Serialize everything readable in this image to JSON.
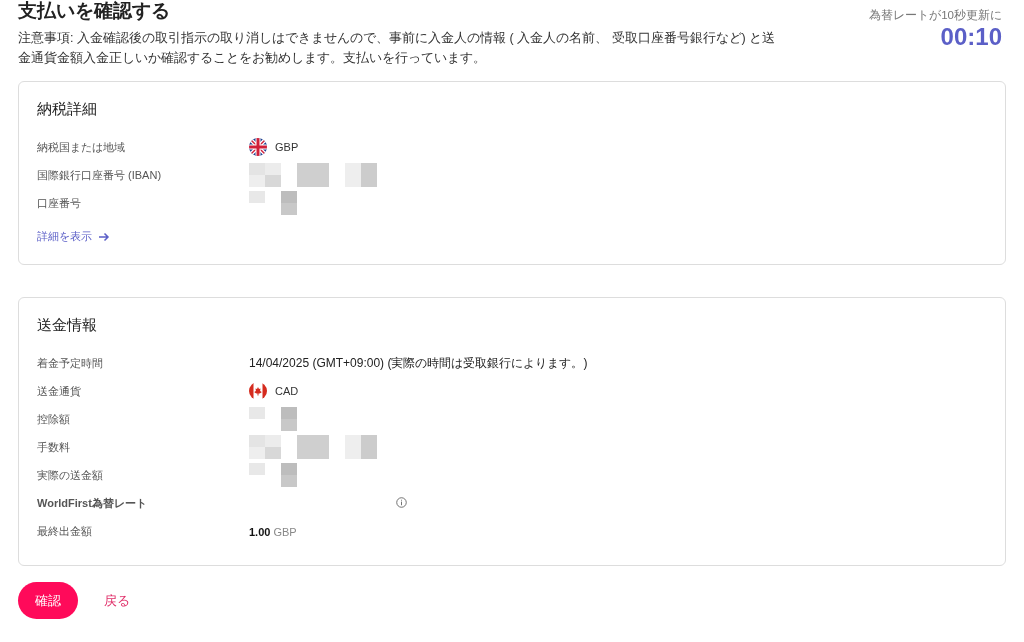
{
  "header": {
    "title": "支払いを確認する",
    "notice": "注意事項: 入金確認後の取引指示の取り消しはできませんので、事前に入金人の情報 ( 入金人の名前、 受取口座番号銀行など) と送金通貨金額入金正しいか確認することをお勧めします。支払いを行っています。",
    "rate_note": "為替レートが10秒更新に",
    "countdown": "00:10"
  },
  "sections": [
    {
      "title": "納税詳細",
      "rows": [
        {
          "label": "納税国または地域",
          "kind": "ukflag",
          "value": "GBP"
        },
        {
          "label": "国際銀行口座番号 (IBAN)",
          "kind": "redacted"
        },
        {
          "label": "口座番号",
          "kind": "redacted"
        }
      ],
      "link": "詳細を表示"
    },
    {
      "title": "送金情報",
      "rows": [
        {
          "label": "着金予定時間",
          "kind": "text",
          "value": "14/04/2025 (GMT+09:00) (実際の時間は受取銀行によります。)"
        },
        {
          "label": "送金通貨",
          "kind": "caflag",
          "value": "CAD"
        },
        {
          "label": "控除額",
          "kind": "redacted"
        },
        {
          "label": "手数料",
          "kind": "redacted"
        },
        {
          "label": "実際の送金額",
          "kind": "redacted"
        },
        {
          "label": "WorldFirst為替レート",
          "kind": "info"
        },
        {
          "label": "最終出金額",
          "kind": "amount",
          "value": "1.00",
          "unit": "GBP"
        }
      ]
    }
  ],
  "buttons": {
    "confirm": "確認",
    "back": "戻る"
  }
}
